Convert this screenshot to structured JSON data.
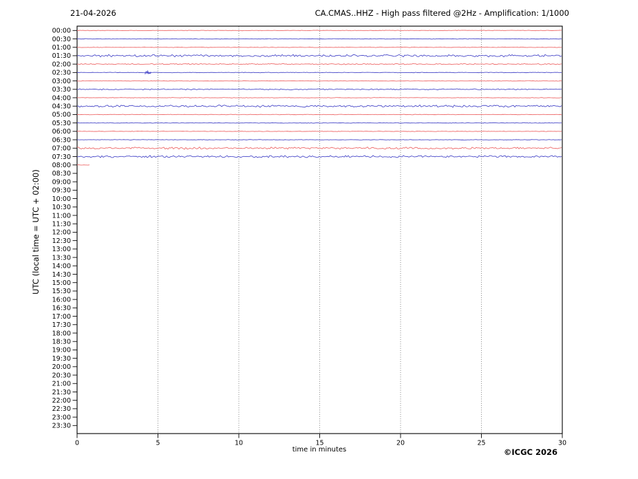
{
  "header": {
    "date": "21-04-2026",
    "title": "CA.CMAS..HHZ - High pass filtered @2Hz - Amplification: 1/1000"
  },
  "footer": {
    "copyright": "©ICGC 2026"
  },
  "chart_data": {
    "type": "line",
    "subtype": "seismogram-dayplot",
    "station": "CA.CMAS..HHZ",
    "date": "21-04-2026",
    "xlabel": "time in minutes",
    "ylabel": "UTC (local time = UTC + 02:00)",
    "xlim": [
      0,
      30
    ],
    "x_ticks": [
      0,
      5,
      10,
      15,
      20,
      25,
      30
    ],
    "grid": {
      "vertical_dotted_at": [
        5,
        10,
        15,
        20,
        25
      ]
    },
    "y_ticks": [
      "00:00",
      "00:30",
      "01:00",
      "01:30",
      "02:00",
      "02:30",
      "03:00",
      "03:30",
      "04:00",
      "04:30",
      "05:00",
      "05:30",
      "06:00",
      "06:30",
      "07:00",
      "07:30",
      "08:00",
      "08:30",
      "09:00",
      "09:30",
      "10:00",
      "10:30",
      "11:00",
      "11:30",
      "12:00",
      "12:30",
      "13:00",
      "13:30",
      "14:00",
      "14:30",
      "15:00",
      "15:30",
      "16:00",
      "16:30",
      "17:00",
      "17:30",
      "18:00",
      "18:30",
      "19:00",
      "19:30",
      "20:00",
      "20:30",
      "21:00",
      "21:30",
      "22:00",
      "22:30",
      "23:00",
      "23:30"
    ],
    "colors": {
      "trace_red": "#ee6a6a",
      "trace_blue": "#4a4ac9",
      "grid": "#606060",
      "axis": "#000000",
      "background": "#ffffff"
    },
    "traces": [
      {
        "time": "00:00",
        "color": "red",
        "start_min": 0,
        "end_min": 30,
        "amplitude": "low"
      },
      {
        "time": "00:30",
        "color": "blue",
        "start_min": 0,
        "end_min": 30,
        "amplitude": "low"
      },
      {
        "time": "01:00",
        "color": "red",
        "start_min": 0,
        "end_min": 30,
        "amplitude": "low"
      },
      {
        "time": "01:30",
        "color": "blue",
        "start_min": 0,
        "end_min": 30,
        "amplitude": "high"
      },
      {
        "time": "02:00",
        "color": "red",
        "start_min": 0,
        "end_min": 30,
        "amplitude": "medium"
      },
      {
        "time": "02:30",
        "color": "blue",
        "start_min": 0,
        "end_min": 30,
        "amplitude": "low",
        "event_at_min": 4.4
      },
      {
        "time": "03:00",
        "color": "red",
        "start_min": 0,
        "end_min": 30,
        "amplitude": "low"
      },
      {
        "time": "03:30",
        "color": "blue",
        "start_min": 0,
        "end_min": 30,
        "amplitude": "medium"
      },
      {
        "time": "04:00",
        "color": "red",
        "start_min": 0,
        "end_min": 30,
        "amplitude": "low"
      },
      {
        "time": "04:30",
        "color": "blue",
        "start_min": 0,
        "end_min": 30,
        "amplitude": "high"
      },
      {
        "time": "05:00",
        "color": "red",
        "start_min": 0,
        "end_min": 30,
        "amplitude": "low"
      },
      {
        "time": "05:30",
        "color": "blue",
        "start_min": 0,
        "end_min": 30,
        "amplitude": "low"
      },
      {
        "time": "06:00",
        "color": "red",
        "start_min": 0,
        "end_min": 30,
        "amplitude": "low"
      },
      {
        "time": "06:30",
        "color": "blue",
        "start_min": 0,
        "end_min": 30,
        "amplitude": "low"
      },
      {
        "time": "07:00",
        "color": "red",
        "start_min": 0,
        "end_min": 30,
        "amplitude": "high"
      },
      {
        "time": "07:30",
        "color": "blue",
        "start_min": 0,
        "end_min": 30,
        "amplitude": "high"
      },
      {
        "time": "08:00",
        "color": "red",
        "start_min": 0,
        "end_min": 0.8,
        "amplitude": "low"
      }
    ],
    "empty_rows_from": "08:30"
  }
}
